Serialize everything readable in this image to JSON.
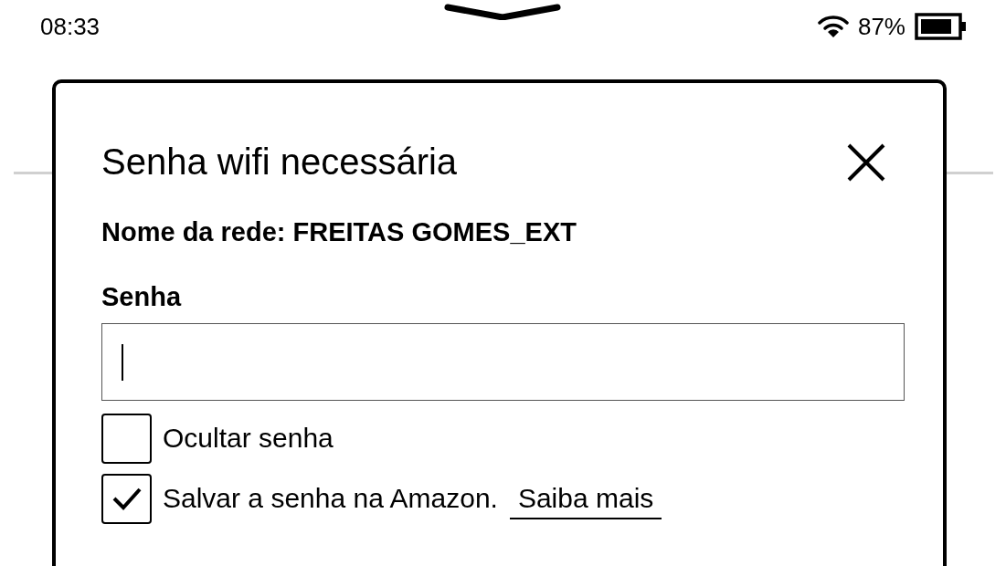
{
  "status_bar": {
    "time": "08:33",
    "battery": "87%"
  },
  "dialog": {
    "title": "Senha wifi necessária",
    "network": "Nome da rede: FREITAS GOMES_EXT",
    "password_label": "Senha",
    "password_field": {
      "focused": true
    },
    "options": [
      {
        "label": "Ocultar senha",
        "checked": false
      },
      {
        "label": "Salvar a senha na Amazon.",
        "checked": true,
        "link": "Saiba mais"
      }
    ]
  }
}
